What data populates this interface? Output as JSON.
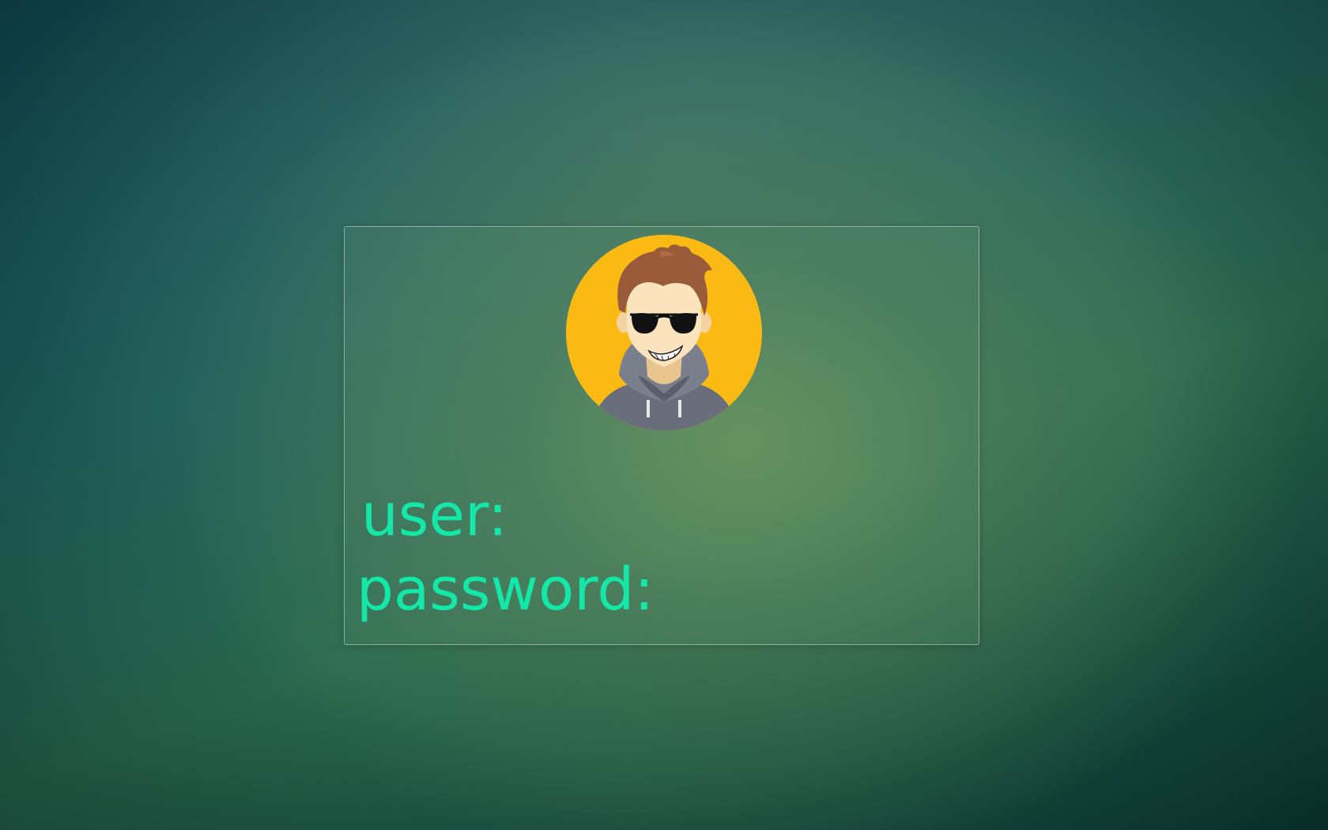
{
  "login": {
    "user_label": "user:",
    "password_label": "password:",
    "avatar_icon": "user-avatar-sunglasses-icon"
  },
  "colors": {
    "label_text": "#14e8a8",
    "avatar_background": "#fbb914",
    "hair": "#9a5b3a",
    "hoodie": "#6a6e7a"
  }
}
